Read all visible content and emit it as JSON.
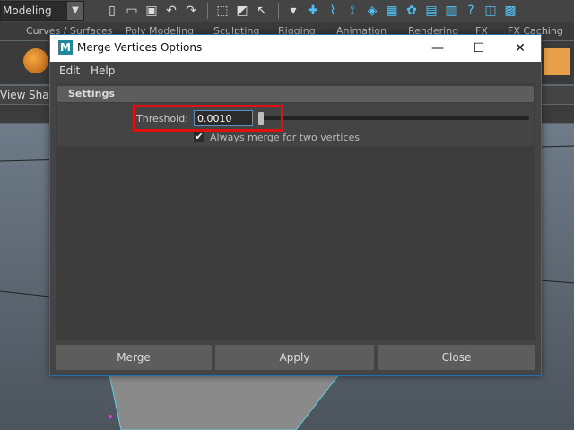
{
  "app": {
    "mode": "Modeling",
    "shelf_tabs": [
      "Curves / Surfaces",
      "Poly Modeling",
      "Sculpting",
      "Rigging",
      "Animation",
      "Rendering",
      "FX",
      "FX Caching"
    ],
    "panel_menu": [
      "View",
      "Shading"
    ]
  },
  "dialog": {
    "title": "Merge Vertices Options",
    "menu": [
      "Edit",
      "Help"
    ],
    "section_title": "Settings",
    "threshold_label": "Threshold:",
    "threshold_value": "0.0010",
    "checkbox_label": "Always merge for two vertices",
    "checkbox_checked": true,
    "buttons": {
      "merge": "Merge",
      "apply": "Apply",
      "close": "Close"
    }
  },
  "colors": {
    "highlight": "#e01010",
    "accent": "#1f6fb5"
  }
}
